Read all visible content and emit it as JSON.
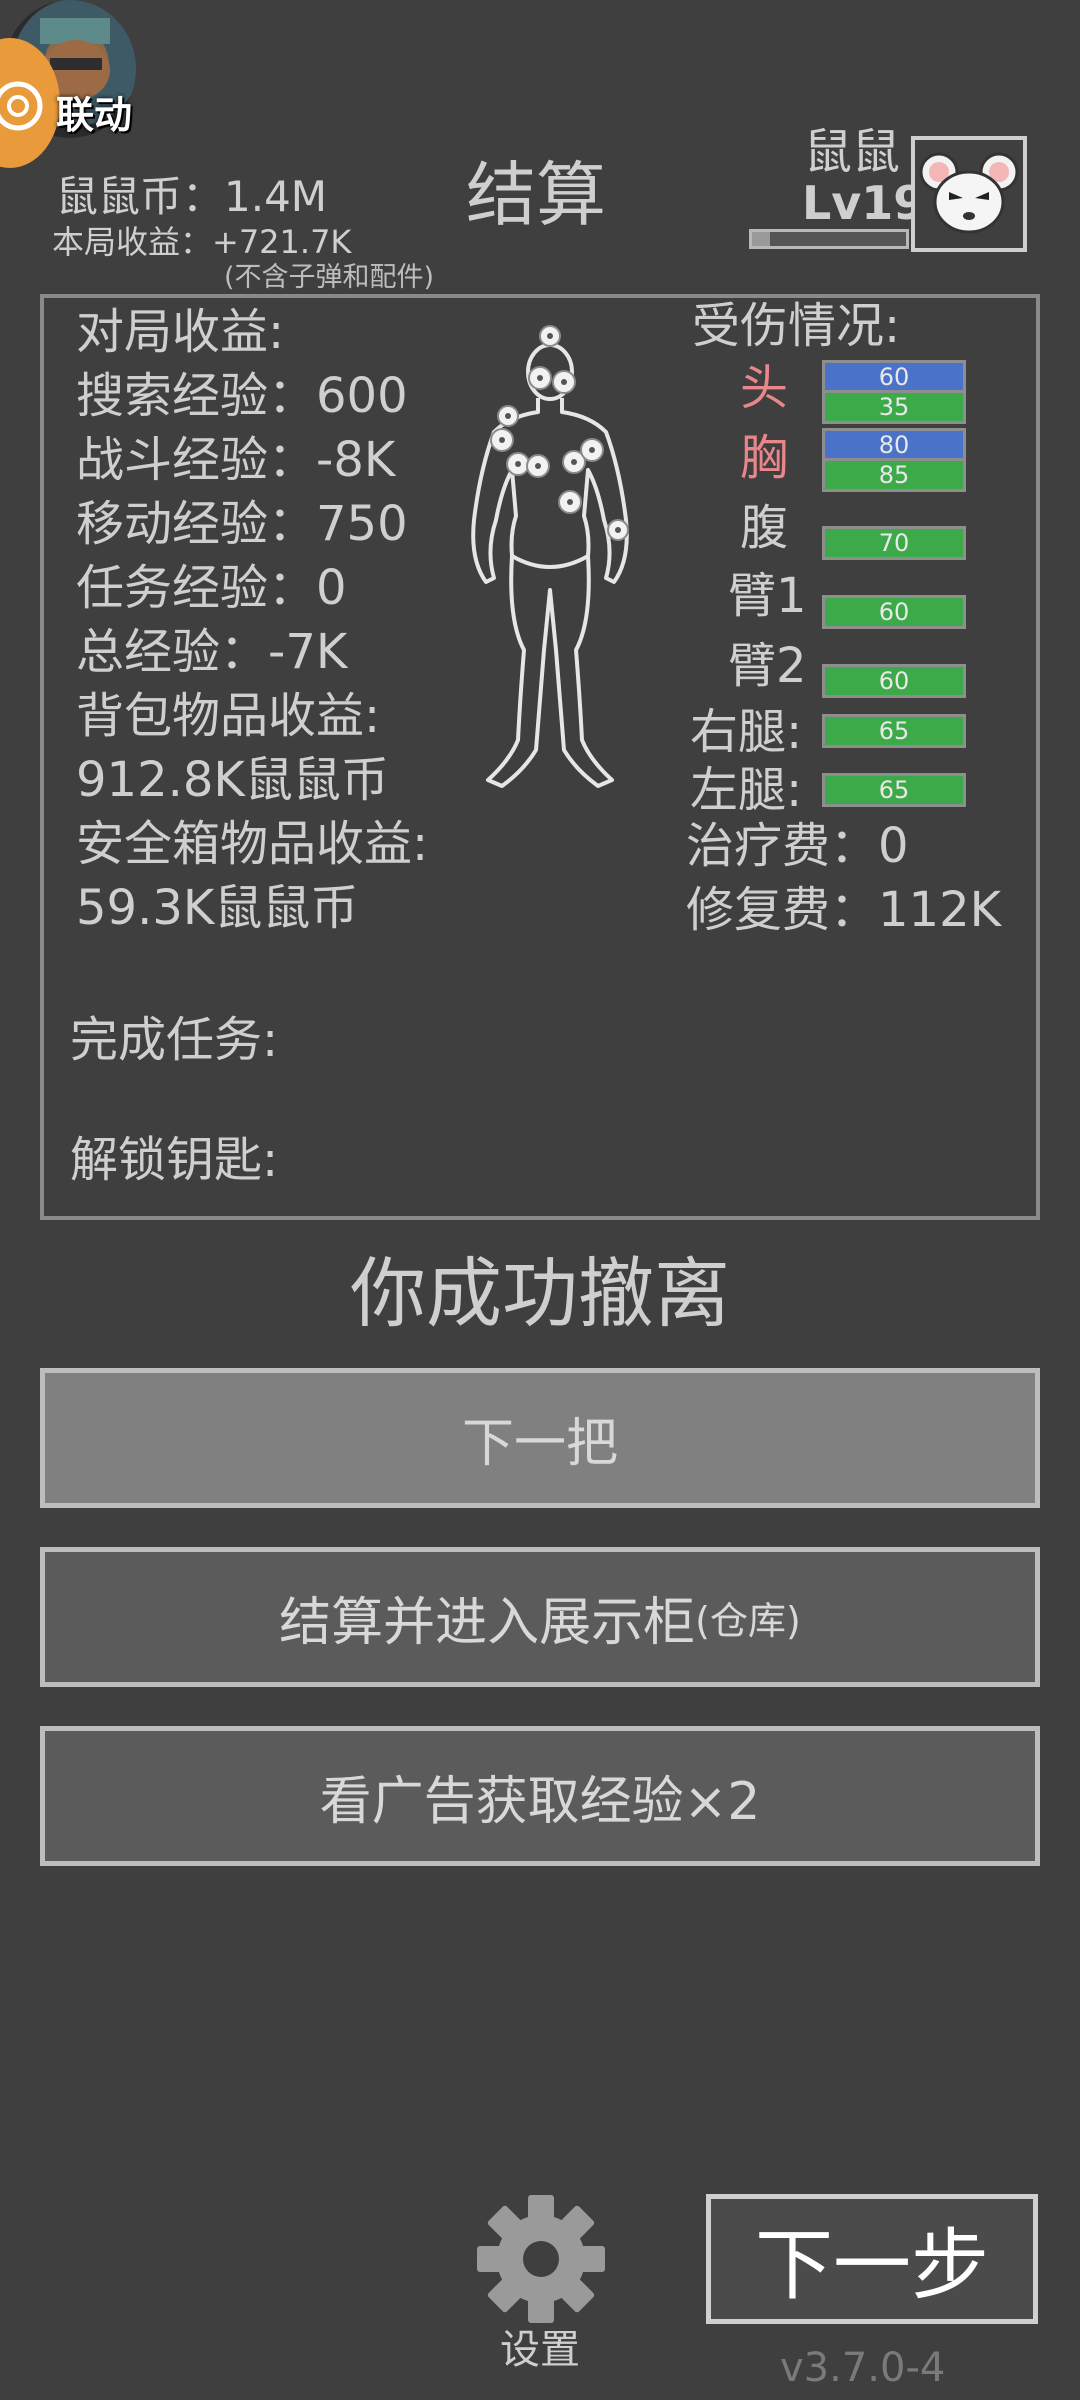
{
  "badge": {
    "text": "联动"
  },
  "header": {
    "coins": "鼠鼠币：1.4M",
    "round_income": "本局收益：+721.7K",
    "excluded_note": "(不含子弹和配件)",
    "title": "结算",
    "player_name": "鼠鼠",
    "player_level": "Lv19",
    "level_progress": 0.12
  },
  "stats": {
    "match_income": "对局收益:",
    "search_exp": "搜索经验：600",
    "combat_exp": "战斗经验：-8K",
    "move_exp": "移动经验：750",
    "task_exp": "任务经验：0",
    "total_exp": "总经验：-7K",
    "backpack_label": "背包物品收益:",
    "backpack_value": "912.8K鼠鼠币",
    "safebox_label": "安全箱物品收益:",
    "safebox_value": "59.3K鼠鼠币",
    "tasks_done": "完成任务:",
    "keys_unlocked": "解锁钥匙:"
  },
  "injury": {
    "title": "受伤情况:",
    "parts": [
      {
        "label": "头",
        "blue": "60",
        "green": "35"
      },
      {
        "label": "胸",
        "blue": "80",
        "green": "85"
      },
      {
        "label": "腹",
        "green": "70"
      },
      {
        "label": "臂1",
        "green": "60"
      },
      {
        "label": "臂2",
        "green": "60"
      },
      {
        "label": "右腿:",
        "green": "65"
      },
      {
        "label": "左腿:",
        "green": "65"
      }
    ],
    "heal_fee": "治疗费：0",
    "repair_fee": "修复费：112K"
  },
  "message": "你成功撤离",
  "buttons": {
    "next_round": "下一把",
    "showcase": "结算并进入展示柜",
    "showcase_sub": "(仓库)",
    "ad": "看广告获取经验×2",
    "next_step": "下一步"
  },
  "footer": {
    "settings": "设置",
    "version": "v3.7.0-4"
  },
  "colors": {
    "background": "#3f3f3f",
    "injured_red": "#e9868a",
    "armor_blue": "#4a72c9",
    "health_green": "#3daa4a"
  }
}
